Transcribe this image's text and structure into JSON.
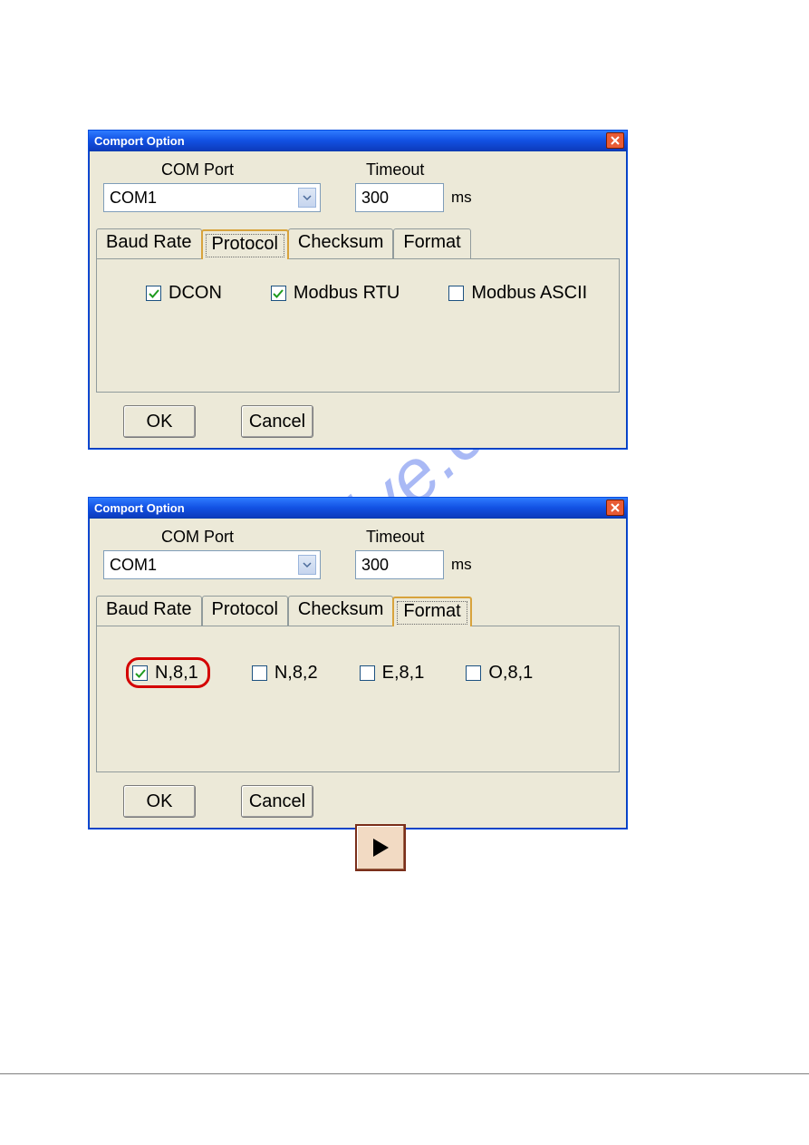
{
  "watermark": "manualshive.com",
  "dialog1": {
    "title": "Comport Option",
    "comport_label": "COM Port",
    "comport_value": "COM1",
    "timeout_label": "Timeout",
    "timeout_value": "300",
    "ms": "ms",
    "tabs": [
      "Baud Rate",
      "Protocol",
      "Checksum",
      "Format"
    ],
    "active_tab": 1,
    "checks": [
      {
        "label": "DCON",
        "checked": true
      },
      {
        "label": "Modbus RTU",
        "checked": true
      },
      {
        "label": "Modbus ASCII",
        "checked": false
      }
    ],
    "ok": "OK",
    "cancel": "Cancel"
  },
  "dialog2": {
    "title": "Comport Option",
    "comport_label": "COM Port",
    "comport_value": "COM1",
    "timeout_label": "Timeout",
    "timeout_value": "300",
    "ms": "ms",
    "tabs": [
      "Baud Rate",
      "Protocol",
      "Checksum",
      "Format"
    ],
    "active_tab": 3,
    "checks": [
      {
        "label": "N,8,1",
        "checked": true,
        "highlight": true
      },
      {
        "label": "N,8,2",
        "checked": false
      },
      {
        "label": "E,8,1",
        "checked": false
      },
      {
        "label": "O,8,1",
        "checked": false
      }
    ],
    "ok": "OK",
    "cancel": "Cancel"
  }
}
